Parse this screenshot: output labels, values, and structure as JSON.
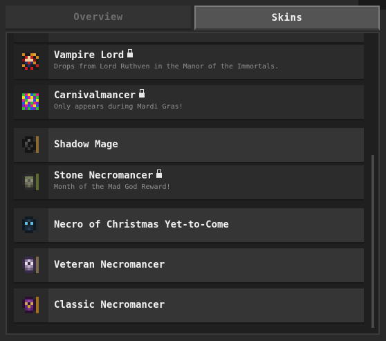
{
  "tabs": {
    "overview": "Overview",
    "skins": "Skins"
  },
  "skins": [
    {
      "name": "",
      "description": "",
      "locked": false,
      "partial": true
    },
    {
      "name": "Vampire Lord",
      "description": "Drops from Lord Ruthven in the Manor of the Immortals.",
      "locked": true,
      "sprite": "vampire"
    },
    {
      "name": "Carnivalmancer",
      "description": "Only appears during Mardi Gras!",
      "locked": true,
      "sprite": "carnival"
    },
    {
      "name": "Shadow Mage",
      "description": "",
      "locked": false,
      "sprite": "shadow"
    },
    {
      "name": "Stone Necromancer",
      "description": "Month of the Mad God Reward!",
      "locked": true,
      "sprite": "stone"
    },
    {
      "name": "Necro of Christmas Yet-to-Come",
      "description": "",
      "locked": false,
      "sprite": "christmas"
    },
    {
      "name": "Veteran Necromancer",
      "description": "",
      "locked": false,
      "sprite": "veteran"
    },
    {
      "name": "Classic Necromancer",
      "description": "",
      "locked": false,
      "sprite": "classic"
    }
  ],
  "icons": {
    "lock": "lock-icon"
  },
  "colors": {
    "background": "#2a2a2a",
    "panel": "#1f1f1f",
    "row_locked": "#2c2c2c",
    "row_unlocked": "#353535",
    "active_tab": "#545454",
    "inactive_tab_text": "#6e6e6e",
    "text": "#f0f0f0",
    "description_text": "#8f8f8f"
  }
}
